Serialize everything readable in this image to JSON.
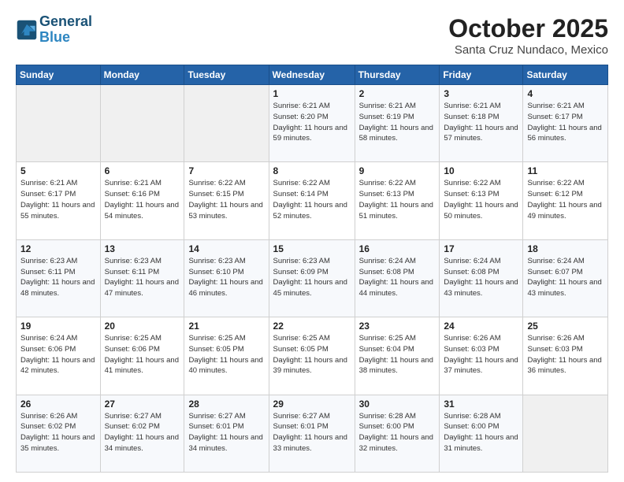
{
  "header": {
    "logo_line1": "General",
    "logo_line2": "Blue",
    "month": "October 2025",
    "location": "Santa Cruz Nundaco, Mexico"
  },
  "days_of_week": [
    "Sunday",
    "Monday",
    "Tuesday",
    "Wednesday",
    "Thursday",
    "Friday",
    "Saturday"
  ],
  "weeks": [
    [
      {
        "day": "",
        "sunrise": "",
        "sunset": "",
        "daylight": ""
      },
      {
        "day": "",
        "sunrise": "",
        "sunset": "",
        "daylight": ""
      },
      {
        "day": "",
        "sunrise": "",
        "sunset": "",
        "daylight": ""
      },
      {
        "day": "1",
        "sunrise": "Sunrise: 6:21 AM",
        "sunset": "Sunset: 6:20 PM",
        "daylight": "Daylight: 11 hours and 59 minutes."
      },
      {
        "day": "2",
        "sunrise": "Sunrise: 6:21 AM",
        "sunset": "Sunset: 6:19 PM",
        "daylight": "Daylight: 11 hours and 58 minutes."
      },
      {
        "day": "3",
        "sunrise": "Sunrise: 6:21 AM",
        "sunset": "Sunset: 6:18 PM",
        "daylight": "Daylight: 11 hours and 57 minutes."
      },
      {
        "day": "4",
        "sunrise": "Sunrise: 6:21 AM",
        "sunset": "Sunset: 6:17 PM",
        "daylight": "Daylight: 11 hours and 56 minutes."
      }
    ],
    [
      {
        "day": "5",
        "sunrise": "Sunrise: 6:21 AM",
        "sunset": "Sunset: 6:17 PM",
        "daylight": "Daylight: 11 hours and 55 minutes."
      },
      {
        "day": "6",
        "sunrise": "Sunrise: 6:21 AM",
        "sunset": "Sunset: 6:16 PM",
        "daylight": "Daylight: 11 hours and 54 minutes."
      },
      {
        "day": "7",
        "sunrise": "Sunrise: 6:22 AM",
        "sunset": "Sunset: 6:15 PM",
        "daylight": "Daylight: 11 hours and 53 minutes."
      },
      {
        "day": "8",
        "sunrise": "Sunrise: 6:22 AM",
        "sunset": "Sunset: 6:14 PM",
        "daylight": "Daylight: 11 hours and 52 minutes."
      },
      {
        "day": "9",
        "sunrise": "Sunrise: 6:22 AM",
        "sunset": "Sunset: 6:13 PM",
        "daylight": "Daylight: 11 hours and 51 minutes."
      },
      {
        "day": "10",
        "sunrise": "Sunrise: 6:22 AM",
        "sunset": "Sunset: 6:13 PM",
        "daylight": "Daylight: 11 hours and 50 minutes."
      },
      {
        "day": "11",
        "sunrise": "Sunrise: 6:22 AM",
        "sunset": "Sunset: 6:12 PM",
        "daylight": "Daylight: 11 hours and 49 minutes."
      }
    ],
    [
      {
        "day": "12",
        "sunrise": "Sunrise: 6:23 AM",
        "sunset": "Sunset: 6:11 PM",
        "daylight": "Daylight: 11 hours and 48 minutes."
      },
      {
        "day": "13",
        "sunrise": "Sunrise: 6:23 AM",
        "sunset": "Sunset: 6:11 PM",
        "daylight": "Daylight: 11 hours and 47 minutes."
      },
      {
        "day": "14",
        "sunrise": "Sunrise: 6:23 AM",
        "sunset": "Sunset: 6:10 PM",
        "daylight": "Daylight: 11 hours and 46 minutes."
      },
      {
        "day": "15",
        "sunrise": "Sunrise: 6:23 AM",
        "sunset": "Sunset: 6:09 PM",
        "daylight": "Daylight: 11 hours and 45 minutes."
      },
      {
        "day": "16",
        "sunrise": "Sunrise: 6:24 AM",
        "sunset": "Sunset: 6:08 PM",
        "daylight": "Daylight: 11 hours and 44 minutes."
      },
      {
        "day": "17",
        "sunrise": "Sunrise: 6:24 AM",
        "sunset": "Sunset: 6:08 PM",
        "daylight": "Daylight: 11 hours and 43 minutes."
      },
      {
        "day": "18",
        "sunrise": "Sunrise: 6:24 AM",
        "sunset": "Sunset: 6:07 PM",
        "daylight": "Daylight: 11 hours and 43 minutes."
      }
    ],
    [
      {
        "day": "19",
        "sunrise": "Sunrise: 6:24 AM",
        "sunset": "Sunset: 6:06 PM",
        "daylight": "Daylight: 11 hours and 42 minutes."
      },
      {
        "day": "20",
        "sunrise": "Sunrise: 6:25 AM",
        "sunset": "Sunset: 6:06 PM",
        "daylight": "Daylight: 11 hours and 41 minutes."
      },
      {
        "day": "21",
        "sunrise": "Sunrise: 6:25 AM",
        "sunset": "Sunset: 6:05 PM",
        "daylight": "Daylight: 11 hours and 40 minutes."
      },
      {
        "day": "22",
        "sunrise": "Sunrise: 6:25 AM",
        "sunset": "Sunset: 6:05 PM",
        "daylight": "Daylight: 11 hours and 39 minutes."
      },
      {
        "day": "23",
        "sunrise": "Sunrise: 6:25 AM",
        "sunset": "Sunset: 6:04 PM",
        "daylight": "Daylight: 11 hours and 38 minutes."
      },
      {
        "day": "24",
        "sunrise": "Sunrise: 6:26 AM",
        "sunset": "Sunset: 6:03 PM",
        "daylight": "Daylight: 11 hours and 37 minutes."
      },
      {
        "day": "25",
        "sunrise": "Sunrise: 6:26 AM",
        "sunset": "Sunset: 6:03 PM",
        "daylight": "Daylight: 11 hours and 36 minutes."
      }
    ],
    [
      {
        "day": "26",
        "sunrise": "Sunrise: 6:26 AM",
        "sunset": "Sunset: 6:02 PM",
        "daylight": "Daylight: 11 hours and 35 minutes."
      },
      {
        "day": "27",
        "sunrise": "Sunrise: 6:27 AM",
        "sunset": "Sunset: 6:02 PM",
        "daylight": "Daylight: 11 hours and 34 minutes."
      },
      {
        "day": "28",
        "sunrise": "Sunrise: 6:27 AM",
        "sunset": "Sunset: 6:01 PM",
        "daylight": "Daylight: 11 hours and 34 minutes."
      },
      {
        "day": "29",
        "sunrise": "Sunrise: 6:27 AM",
        "sunset": "Sunset: 6:01 PM",
        "daylight": "Daylight: 11 hours and 33 minutes."
      },
      {
        "day": "30",
        "sunrise": "Sunrise: 6:28 AM",
        "sunset": "Sunset: 6:00 PM",
        "daylight": "Daylight: 11 hours and 32 minutes."
      },
      {
        "day": "31",
        "sunrise": "Sunrise: 6:28 AM",
        "sunset": "Sunset: 6:00 PM",
        "daylight": "Daylight: 11 hours and 31 minutes."
      },
      {
        "day": "",
        "sunrise": "",
        "sunset": "",
        "daylight": ""
      }
    ]
  ]
}
